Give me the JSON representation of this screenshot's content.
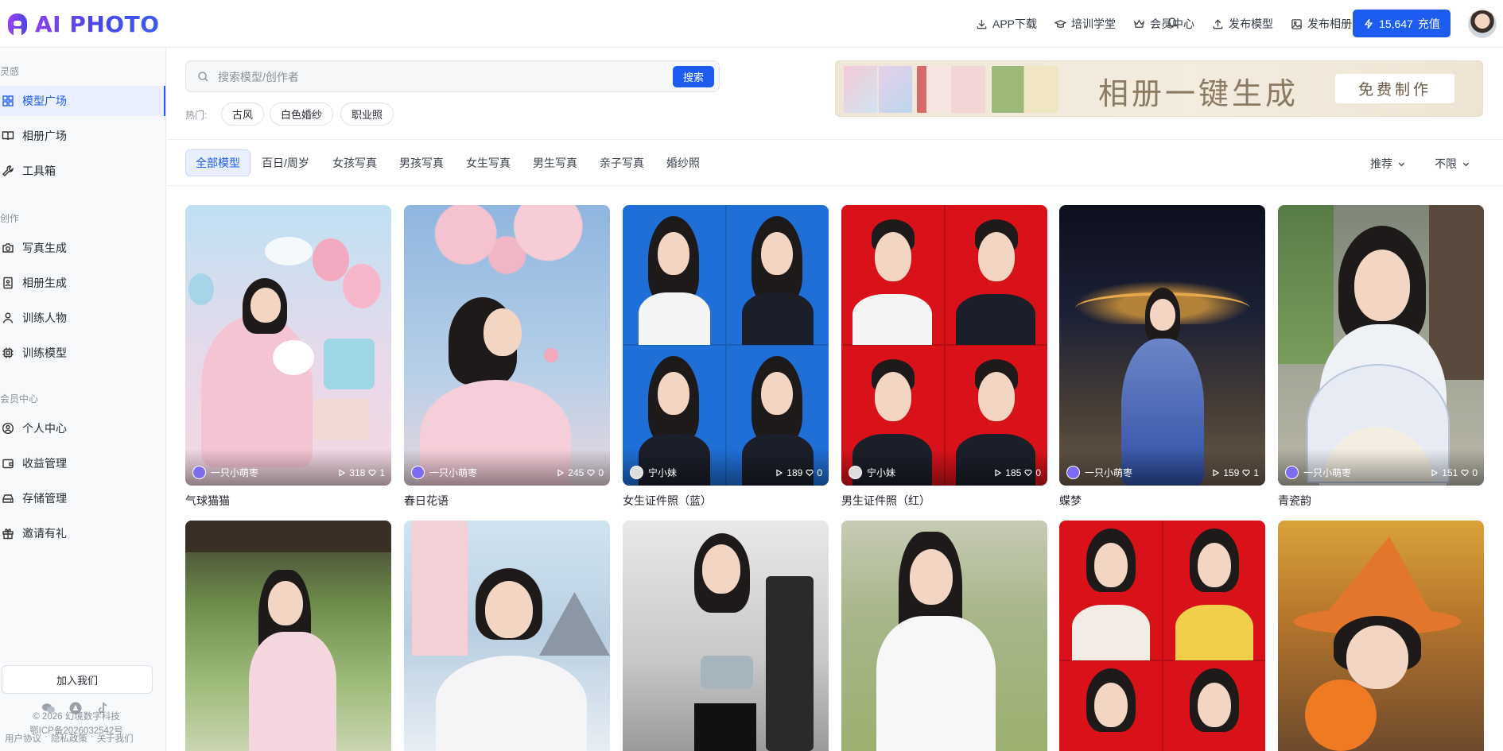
{
  "app": {
    "logo_text": "AI PHOTO"
  },
  "header": {
    "nav": [
      {
        "label": "APP下载",
        "icon": "download-icon"
      },
      {
        "label": "培训学堂",
        "icon": "graduation-cap-icon"
      },
      {
        "label": "会员中心",
        "icon": "crown-icon"
      },
      {
        "label": "发布模型",
        "icon": "upload-icon"
      },
      {
        "label": "发布相册",
        "icon": "image-icon"
      }
    ],
    "bell_icon": "bell-icon",
    "recharge": {
      "balance": "15,647",
      "label": "充值",
      "icon": "lightning-icon"
    }
  },
  "sidebar": {
    "sections": [
      {
        "title": "灵感",
        "items": [
          {
            "label": "模型广场",
            "icon": "grid-icon",
            "active": true
          },
          {
            "label": "相册广场",
            "icon": "book-open-icon"
          },
          {
            "label": "工具箱",
            "icon": "wrench-icon"
          }
        ]
      },
      {
        "title": "创作",
        "items": [
          {
            "label": "写真生成",
            "icon": "camera-icon"
          },
          {
            "label": "相册生成",
            "icon": "album-icon"
          },
          {
            "label": "训练人物",
            "icon": "user-icon"
          },
          {
            "label": "训练模型",
            "icon": "chip-icon"
          }
        ]
      },
      {
        "title": "会员中心",
        "items": [
          {
            "label": "个人中心",
            "icon": "user-circle-icon"
          },
          {
            "label": "收益管理",
            "icon": "wallet-icon"
          },
          {
            "label": "存储管理",
            "icon": "storage-icon"
          },
          {
            "label": "邀请有礼",
            "icon": "gift-icon"
          }
        ]
      }
    ],
    "join_label": "加入我们",
    "footer_links": [
      "用户协议",
      "隐私政策",
      "关于我们"
    ],
    "footer_sep": "·",
    "copyright": "© 2026 幻境数字科技",
    "icp": "鄂ICP备2026032542号"
  },
  "search": {
    "placeholder": "搜索模型/创作者",
    "value": "",
    "button": "搜索",
    "hot_label": "热门:",
    "hot_tags": [
      "古风",
      "白色婚纱",
      "职业照"
    ]
  },
  "banner": {
    "title": "相册一键生成",
    "button": "免费制作"
  },
  "filters": {
    "tabs": [
      "全部模型",
      "百日/周岁",
      "女孩写真",
      "男孩写真",
      "女生写真",
      "男生写真",
      "亲子写真",
      "婚纱照"
    ],
    "active_tab": 0,
    "sort_label": "推荐",
    "range_label": "不限"
  },
  "cards": [
    {
      "title": "气球猫猫",
      "author": "一只小萌枣",
      "views": "318",
      "likes": "1"
    },
    {
      "title": "春日花语",
      "author": "一只小萌枣",
      "views": "245",
      "likes": "0"
    },
    {
      "title": "女生证件照（蓝）",
      "author": "宁小妹",
      "views": "189",
      "likes": "0"
    },
    {
      "title": "男生证件照（红）",
      "author": "宁小妹",
      "views": "185",
      "likes": "0"
    },
    {
      "title": "蝶梦",
      "author": "一只小萌枣",
      "views": "159",
      "likes": "1"
    },
    {
      "title": "青瓷韵",
      "author": "一只小萌枣",
      "views": "151",
      "likes": "0"
    },
    {
      "title": "",
      "author": "",
      "views": "",
      "likes": ""
    },
    {
      "title": "",
      "author": "",
      "views": "",
      "likes": ""
    },
    {
      "title": "",
      "author": "",
      "views": "",
      "likes": ""
    },
    {
      "title": "",
      "author": "",
      "views": "",
      "likes": ""
    },
    {
      "title": "",
      "author": "",
      "views": "",
      "likes": ""
    },
    {
      "title": "",
      "author": "",
      "views": "",
      "likes": ""
    }
  ]
}
